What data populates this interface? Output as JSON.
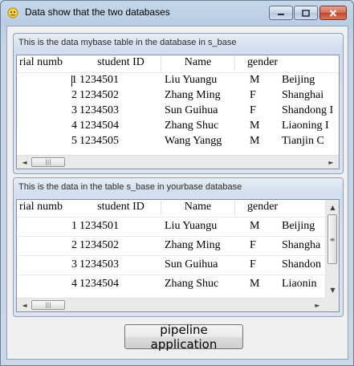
{
  "window": {
    "title": "Data show that the two databases",
    "icon": "app-face-icon",
    "buttons": {
      "minimize": "minimize-icon",
      "maximize": "maximize-icon",
      "close": "close-icon"
    }
  },
  "groups": [
    {
      "caption": "This is the data mybase table in the database in s_base",
      "columns": [
        "rial numb",
        "student ID",
        "Name",
        "gender",
        ""
      ],
      "rows": [
        [
          "1",
          "1234501",
          "Liu Yuangu",
          "M",
          "Beijing"
        ],
        [
          "2",
          "1234502",
          "Zhang Ming",
          "F",
          "Shanghai"
        ],
        [
          "3",
          "1234503",
          "Sun Guihua",
          "F",
          "Shandong I"
        ],
        [
          "4",
          "1234504",
          "Zhang Shuc",
          "M",
          "Liaoning I"
        ],
        [
          "5",
          "1234505",
          "Wang Yangg",
          "M",
          "Tianjin C"
        ]
      ]
    },
    {
      "caption": "This is the data in the table s_base in yourbase database",
      "columns": [
        "rial numb",
        "student ID",
        "Name",
        "gender",
        ""
      ],
      "rows": [
        [
          "1",
          "1234501",
          "Liu Yuangu",
          "M",
          "Beijing"
        ],
        [
          "2",
          "1234502",
          "Zhang Ming",
          "F",
          "Shangha"
        ],
        [
          "3",
          "1234503",
          "Sun Guihua",
          "F",
          "Shandon"
        ],
        [
          "4",
          "1234504",
          "Zhang Shuc",
          "M",
          "Liaonin"
        ]
      ]
    }
  ],
  "scroll_glyphs": {
    "left": "◄",
    "right": "►",
    "up": "▲",
    "down": "▼",
    "grip_h": "|||",
    "grip_v": "≡"
  },
  "action_button": {
    "label": "pipeline application"
  }
}
